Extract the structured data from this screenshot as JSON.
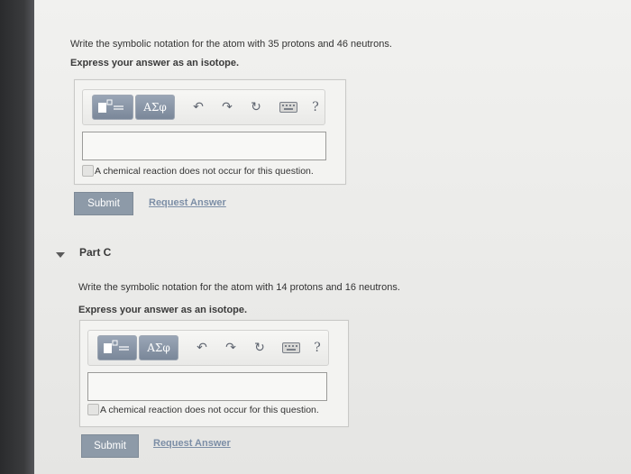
{
  "part_b": {
    "question": "Write the symbolic notation for the atom with 35 protons and 46 neutrons.",
    "instruction": "Express your answer as an isotope.",
    "toolbar": {
      "templates_icon": "templates-icon",
      "greek_label": "ΑΣφ",
      "undo_icon": "undo-icon",
      "redo_icon": "redo-icon",
      "reset_icon": "reset-icon",
      "keyboard_icon": "keyboard-icon",
      "help_label": "?"
    },
    "answer_value": "",
    "no_reaction_label": "A chemical reaction does not occur for this question.",
    "submit_label": "Submit",
    "request_answer_label": "Request Answer"
  },
  "part_c": {
    "label": "Part C",
    "question": "Write the symbolic notation for the atom with 14 protons and 16 neutrons.",
    "instruction": "Express your answer as an isotope.",
    "toolbar": {
      "templates_icon": "templates-icon",
      "greek_label": "ΑΣφ",
      "undo_icon": "undo-icon",
      "redo_icon": "redo-icon",
      "reset_icon": "reset-icon",
      "keyboard_icon": "keyboard-icon",
      "help_label": "?"
    },
    "answer_value": "",
    "no_reaction_label": "A chemical reaction does not occur for this question.",
    "submit_label": "Submit",
    "request_answer_label": "Request Answer"
  },
  "colors": {
    "accent_button": "#8d9aa8",
    "link": "#7c8ea6",
    "toolbar_button": "#8896a8"
  }
}
